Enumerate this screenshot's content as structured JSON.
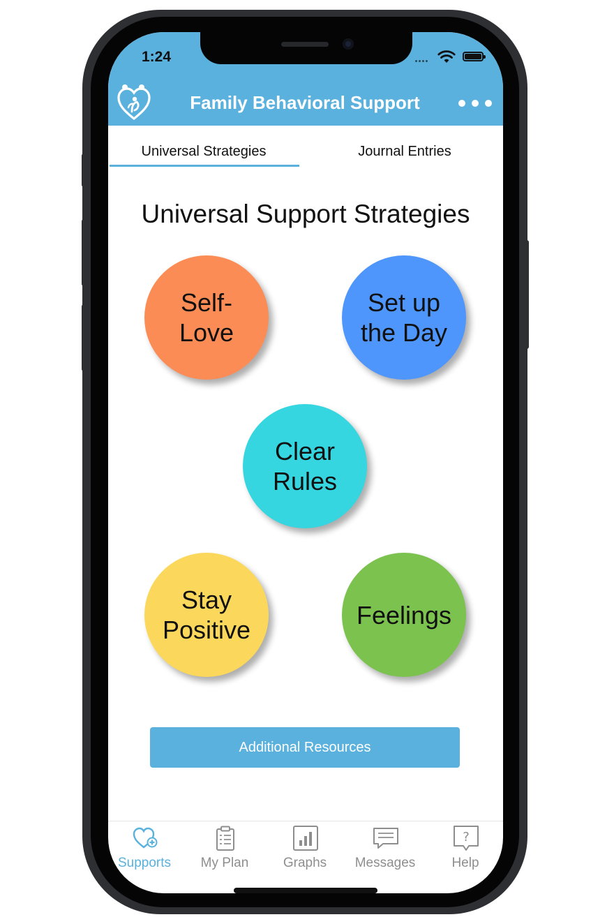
{
  "status_bar": {
    "time": "1:24"
  },
  "header": {
    "title": "Family Behavioral Support"
  },
  "tabs": [
    {
      "label": "Universal Strategies",
      "active": true
    },
    {
      "label": "Journal Entries",
      "active": false
    }
  ],
  "main": {
    "title": "Universal Support Strategies",
    "strategies": [
      {
        "lines": [
          "Self-",
          "Love"
        ],
        "color": "#fb8c55"
      },
      {
        "lines": [
          "Set up",
          "the Day"
        ],
        "color": "#4e96fb"
      },
      {
        "lines": [
          "Clear",
          "Rules"
        ],
        "color": "#35d6e0"
      },
      {
        "lines": [
          "Stay",
          "Positive"
        ],
        "color": "#fbd85b"
      },
      {
        "lines": [
          "Feelings"
        ],
        "color": "#7cc24f"
      }
    ],
    "resources_button": "Additional Resources"
  },
  "bottom_nav": [
    {
      "label": "Supports",
      "icon": "heart-plus-icon",
      "active": true
    },
    {
      "label": "My Plan",
      "icon": "clipboard-icon",
      "active": false
    },
    {
      "label": "Graphs",
      "icon": "bar-chart-icon",
      "active": false
    },
    {
      "label": "Messages",
      "icon": "message-icon",
      "active": false
    },
    {
      "label": "Help",
      "icon": "help-icon",
      "active": false
    }
  ],
  "colors": {
    "accent": "#5ab1de",
    "inactive": "#8e8e8e"
  }
}
